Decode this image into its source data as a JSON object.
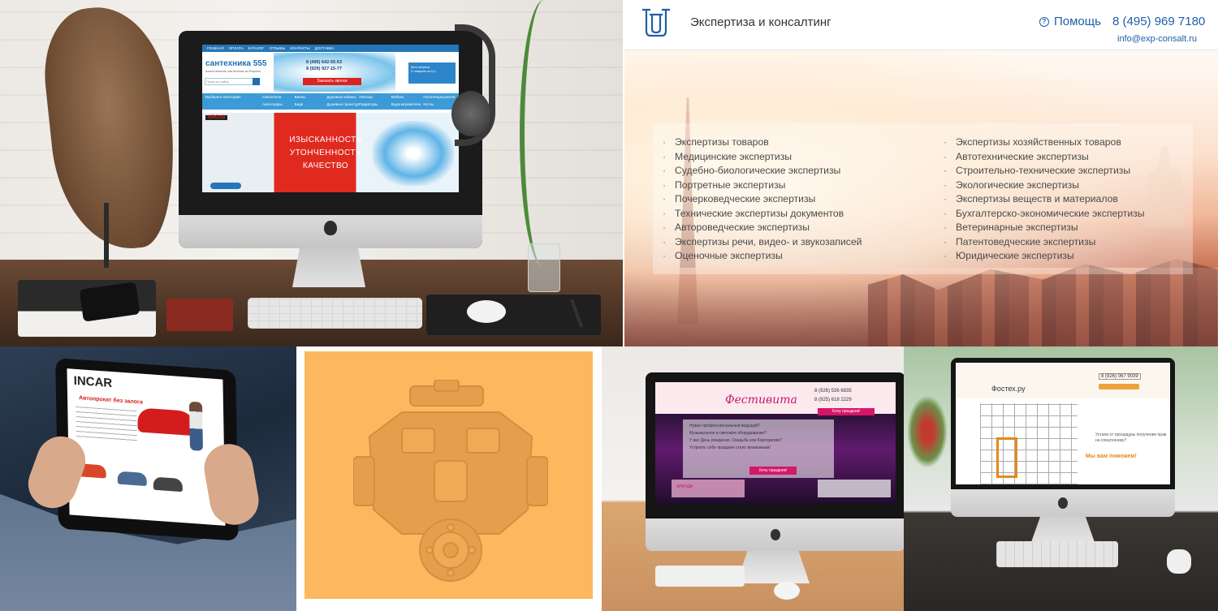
{
  "desk_mockup": {
    "site": {
      "nav": [
        "ГЛАВНАЯ",
        "ОПЛАТА",
        "КАТАЛОГ",
        "ОТЗЫВЫ",
        "КОНТАКТЫ",
        "ДОСТАВКА"
      ],
      "logo": "сантехника 555",
      "logo_sub": "Качественная сантехника из Европы",
      "search_placeholder": "Поиск по сайту",
      "phone_1": "8 (495) 642-55-53",
      "phone_2": "8 (929) 927-15-77",
      "call_button": "Заказать звонок",
      "cart_label": "Моя покупка",
      "cart_items": "0 товаров на 0 р.",
      "menu_choose": "Выберите категорию",
      "menu_items": [
        "Смесители",
        "Ванны",
        "Душевые кабины",
        "Унитазы",
        "Мебель",
        "Полотенцесушители",
        "Аксессуары",
        "Биде",
        "Душевые гарнитуры",
        "Радиаторы",
        "Водонагреватели",
        "Котлы"
      ],
      "brand": "ARCUS",
      "slogan_1": "ИЗЫСКАННОСТЬ",
      "slogan_2": "УТОНЧЕННОСТЬ",
      "slogan_3": "КАЧЕСТВО"
    }
  },
  "expertise": {
    "title": "Экспертиза и консалтинг",
    "help": "Помощь",
    "phone": "8 (495) 969 7180",
    "email": "info@exp-consalt.ru",
    "left_column": [
      "Экспертизы товаров",
      "Медицинские экспертизы",
      "Судебно-биологические экспертизы",
      "Портретные экспертизы",
      "Почерковедческие экспертизы",
      "Технические экспертизы документов",
      "Автороведческие экспертизы",
      "Экспертизы речи, видео- и звукозаписей",
      "Оценочные экспертизы"
    ],
    "right_column": [
      "Экспертизы хозяйственных товаров",
      "Автотехнические экспертизы",
      "Строительно-технические экспертизы",
      "Экологические экспертизы",
      "Экспертизы веществ и материалов",
      "Бухгалтерско-экономические экспертизы",
      "Ветеринарные экспертизы",
      "Патентоведческие экспертизы",
      "Юридические экспертизы"
    ],
    "accent_color": "#1e5fa8"
  },
  "tablet_mockup": {
    "brand": "INCAR",
    "headline": "Автопрокат без залога"
  },
  "engine_tile": {
    "background_color": "#fdb75e",
    "icon": "engine-icon"
  },
  "festivita_mockup": {
    "logo": "Фестивита",
    "phone_1": "8 (926) 536 6835",
    "phone_2": "8 (925) 618 2229",
    "ribbon": "Хочу праздник!",
    "sale_button": "Хочу праздник!",
    "lines": [
      "Нужен профессиональный ведущий?",
      "Музыкальное и световое оборудование?",
      "У вас День рождения, Свадьба или Корпоратив?",
      "Устроить себе праздник стало возможным!"
    ],
    "box_left": "АРЕНДА"
  },
  "fostex_mockup": {
    "logo": "Фостех.ру",
    "phone": "8 (926) 067 9039",
    "line": "Устали от процедуры получения прав на спецтехнику?",
    "cta": "Мы вам поможем!"
  }
}
